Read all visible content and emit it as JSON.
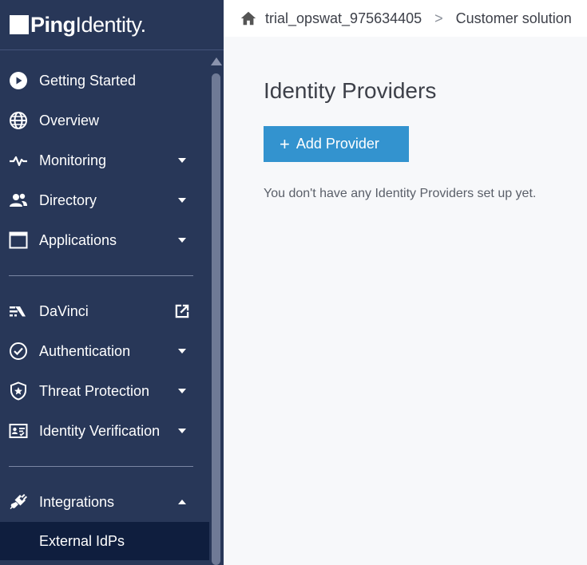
{
  "brand": {
    "logo_bold": "Ping",
    "logo_light": "Identity",
    "logo_mark": "."
  },
  "sidebar": {
    "items": [
      {
        "label": "Getting Started",
        "icon": "play-circle-icon",
        "caret": "none"
      },
      {
        "label": "Overview",
        "icon": "globe-icon",
        "caret": "none"
      },
      {
        "label": "Monitoring",
        "icon": "pulse-icon",
        "caret": "down"
      },
      {
        "label": "Directory",
        "icon": "users-icon",
        "caret": "down"
      },
      {
        "label": "Applications",
        "icon": "window-icon",
        "caret": "down"
      },
      {
        "label": "DaVinci",
        "icon": "davinci-icon",
        "caret": "external"
      },
      {
        "label": "Authentication",
        "icon": "check-circle-icon",
        "caret": "down"
      },
      {
        "label": "Threat Protection",
        "icon": "shield-star-icon",
        "caret": "down"
      },
      {
        "label": "Identity Verification",
        "icon": "id-card-icon",
        "caret": "down"
      },
      {
        "label": "Integrations",
        "icon": "plug-icon",
        "caret": "up"
      }
    ],
    "active_sub_item": "External IdPs"
  },
  "topbar": {
    "breadcrumb": [
      "trial_opswat_975634405",
      "Customer solution"
    ],
    "separator": ">"
  },
  "main": {
    "title": "Identity Providers",
    "add_button_label": "Add Provider",
    "add_button_icon": "+",
    "empty_message": "You don't have any Identity Providers set up yet."
  },
  "colors": {
    "sidebar_bg": "#283758",
    "active_bg": "#0f1e3e",
    "accent_button": "#3393cf",
    "page_bg": "#f7f8fa"
  }
}
